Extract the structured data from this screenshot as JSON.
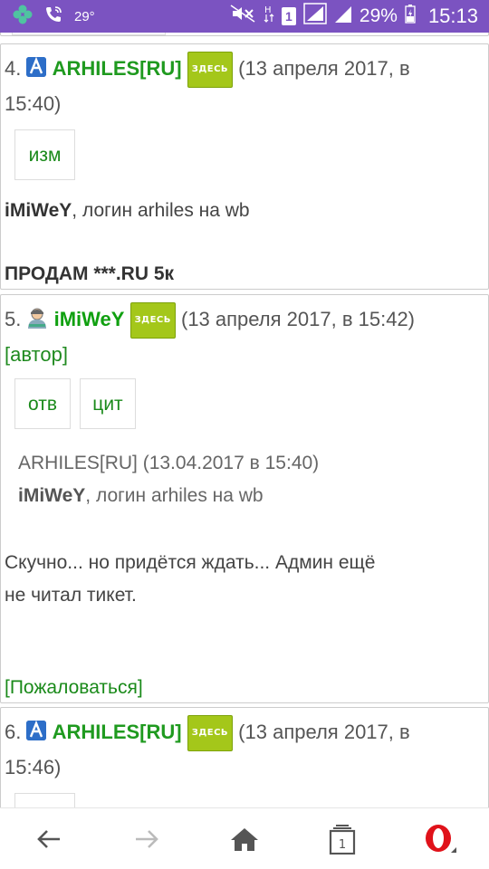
{
  "status_bar": {
    "temperature": "29°",
    "network_badge": "1",
    "battery_percent": "29%",
    "time": "15:13"
  },
  "posts": [
    {
      "number": "4.",
      "username": "ARHILES[RU]",
      "here_badge": "ЗДЕСЬ",
      "date_line1": "(13 апреля 2017, в",
      "date_line2": "15:40)",
      "edit_button": "изм",
      "text_user": "iMiWeY",
      "text_rest": ", логин arhiles на wb",
      "bold_line": "ПРОДАМ ***.RU  5к"
    },
    {
      "number": "5.",
      "username": "iMiWeY",
      "here_badge": "ЗДЕСЬ",
      "date": "(13 апреля 2017, в 15:42)",
      "author_label": "[автор]",
      "reply_button": "отв",
      "quote_button": "цит",
      "quote_header": "ARHILES[RU]  (13.04.2017 в 15:40)",
      "quote_user": "iMiWeY",
      "quote_rest": ", логин arhiles на wb",
      "message_line1": "Скучно... но придётся ждать... Админ ещё",
      "message_line2": "не читал тикет.",
      "complain_link": "[Пожаловаться]"
    },
    {
      "number": "6.",
      "username": "ARHILES[RU]",
      "here_badge": "ЗДЕСЬ",
      "date_line1": "(13 апреля 2017, в",
      "date_line2": "15:46)"
    }
  ],
  "navbar": {
    "tabs_count": "1"
  }
}
